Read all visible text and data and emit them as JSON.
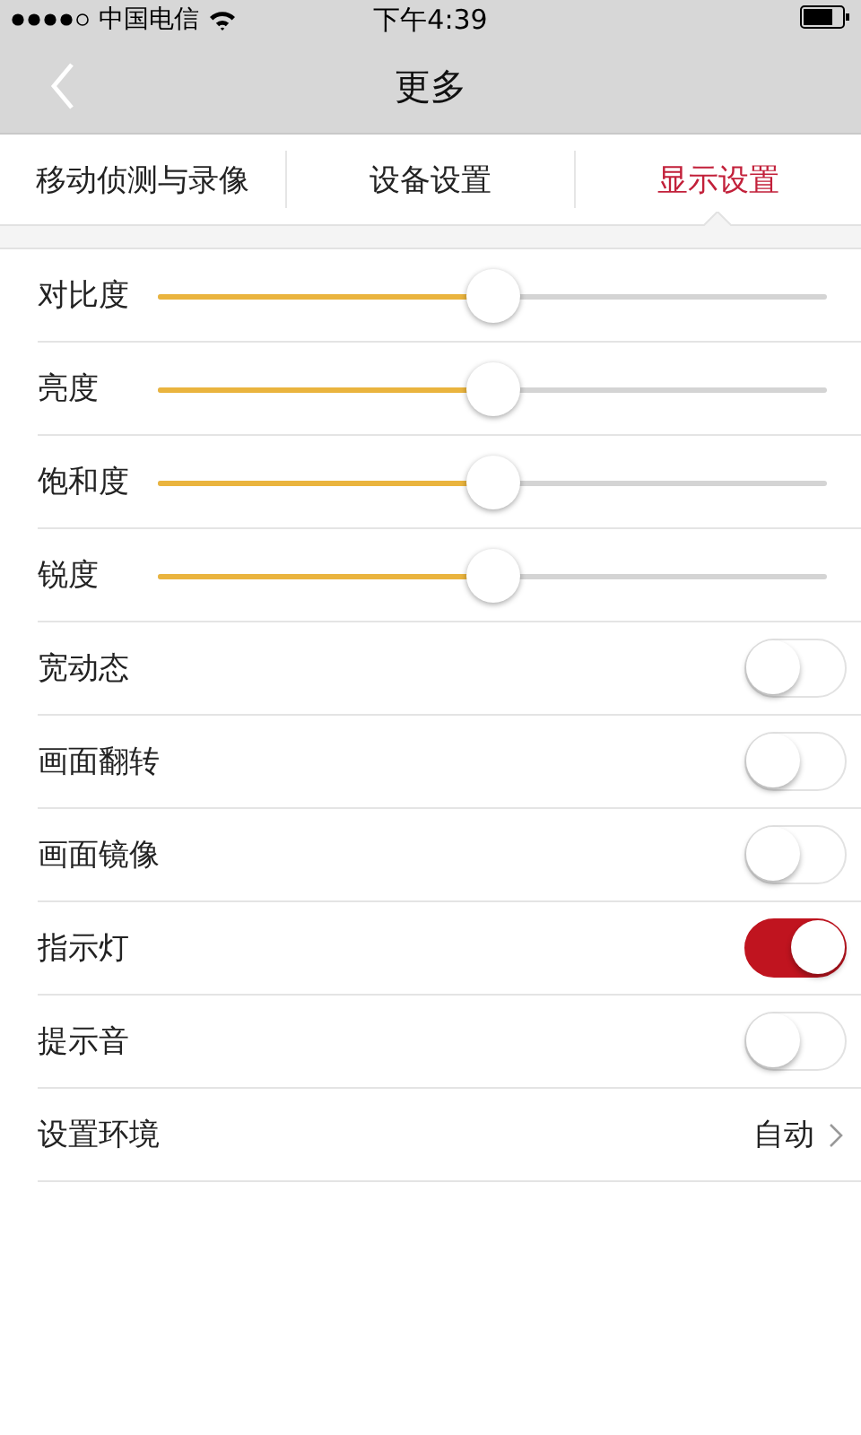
{
  "status_bar": {
    "carrier": "中国电信",
    "time": "下午4:39"
  },
  "nav": {
    "title": "更多"
  },
  "tabs": [
    {
      "label": "移动侦测与录像",
      "selected": false
    },
    {
      "label": "设备设置",
      "selected": false
    },
    {
      "label": "显示设置",
      "selected": true
    }
  ],
  "settings": [
    {
      "kind": "slider",
      "label": "对比度",
      "level": 0.5
    },
    {
      "kind": "slider",
      "label": "亮度",
      "level": 0.5
    },
    {
      "kind": "slider",
      "label": "饱和度",
      "level": 0.5
    },
    {
      "kind": "slider",
      "label": "锐度",
      "level": 0.5
    },
    {
      "kind": "switch",
      "label": "宽动态",
      "on": false
    },
    {
      "kind": "switch",
      "label": "画面翻转",
      "on": false
    },
    {
      "kind": "switch",
      "label": "画面镜像",
      "on": false
    },
    {
      "kind": "switch",
      "label": "指示灯",
      "on": true
    },
    {
      "kind": "switch",
      "label": "提示音",
      "on": false
    },
    {
      "kind": "link",
      "label": "设置环境",
      "value": "自动"
    }
  ]
}
